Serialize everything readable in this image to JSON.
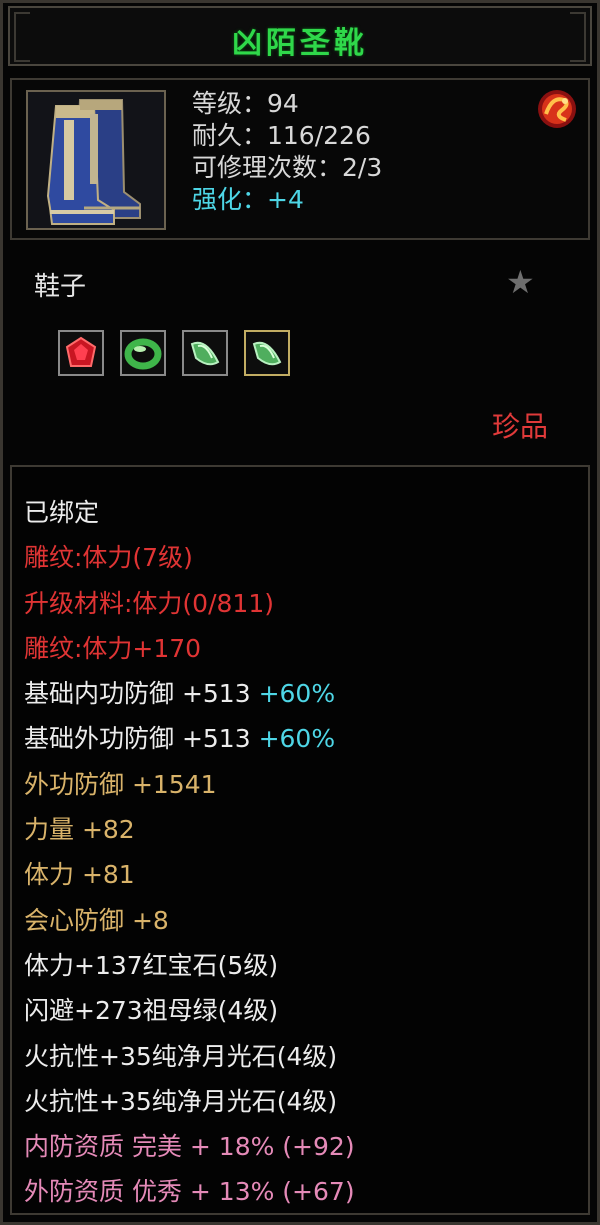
{
  "item": {
    "name": "凶陌圣靴",
    "level_label": "等级：94",
    "durability_label": "耐久：116/226",
    "repair_label": "可修理次数：2/3",
    "enhance_label": "强化：+4",
    "type": "鞋子",
    "rarity": "珍品",
    "icons": {
      "item": "boots-icon",
      "badge": "dragon-badge-icon",
      "star": "star-icon"
    }
  },
  "gems": [
    {
      "name": "ruby-gem-icon",
      "color": "#d81a2a"
    },
    {
      "name": "emerald-ring-icon",
      "color": "#3fb54a"
    },
    {
      "name": "moonstone-gem-icon",
      "color": "#5ac46a"
    },
    {
      "name": "moonstone-gem-icon",
      "color": "#5ac46a"
    }
  ],
  "attributes": {
    "bound": "已绑定",
    "engrave_1": "雕纹:体力(7级)",
    "upgrade_material": "升级材料:体力(0/811)",
    "engrave_2": "雕纹:体力+170",
    "base_inner_def": {
      "label": "基础内功防御 +513",
      "bonus": "+60%"
    },
    "base_outer_def": {
      "label": "基础外功防御 +513",
      "bonus": "+60%"
    },
    "outer_def": "外功防御 +1541",
    "strength": "力量 +82",
    "stamina": "体力 +81",
    "crit_def": "会心防御 +8",
    "gem_1": "体力+137红宝石(5级)",
    "gem_2": "闪避+273祖母绿(4级)",
    "gem_3": "火抗性+35纯净月光石(4级)",
    "gem_4": "火抗性+35纯净月光石(4级)",
    "inner_quality": "内防资质 完美 + 18% (+92)",
    "outer_quality": "外防资质 优秀 + 13% (+67)"
  },
  "colors": {
    "title": "#2fd84a",
    "white": "#ececec",
    "red": "#e03434",
    "gold": "#d9b36a",
    "cyan": "#4ed6e6",
    "pink": "#e58ab8"
  }
}
